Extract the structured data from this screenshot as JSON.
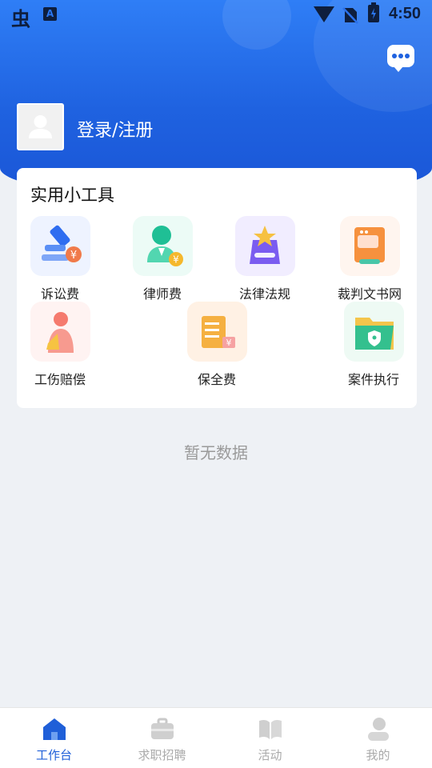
{
  "status_bar": {
    "time": "4:50",
    "app_glyph": "虫",
    "a_glyph": "A"
  },
  "header": {
    "login_label": "登录/注册",
    "message_icon": "chat-bubble-icon"
  },
  "tools": {
    "title": "实用小工具",
    "items": [
      {
        "label": "诉讼费",
        "icon": "gavel-yen-icon"
      },
      {
        "label": "律师费",
        "icon": "lawyer-yen-icon"
      },
      {
        "label": "法律法规",
        "icon": "law-book-star-icon"
      },
      {
        "label": "裁判文书网",
        "icon": "document-web-icon"
      },
      {
        "label": "工伤赔偿",
        "icon": "injury-person-icon"
      },
      {
        "label": "保全费",
        "icon": "receipt-yen-icon"
      },
      {
        "label": "案件执行",
        "icon": "folder-shield-icon"
      }
    ]
  },
  "empty_text": "暂无数据",
  "tabbar": {
    "items": [
      {
        "label": "工作台",
        "icon": "home-icon",
        "active": true
      },
      {
        "label": "求职招聘",
        "icon": "briefcase-icon",
        "active": false
      },
      {
        "label": "活动",
        "icon": "open-book-icon",
        "active": false
      },
      {
        "label": "我的",
        "icon": "person-icon",
        "active": false
      }
    ]
  },
  "colors": {
    "primary": "#1f62e0",
    "active_tab": "#1f5fd8",
    "inactive_tab": "#aaaaaa"
  }
}
